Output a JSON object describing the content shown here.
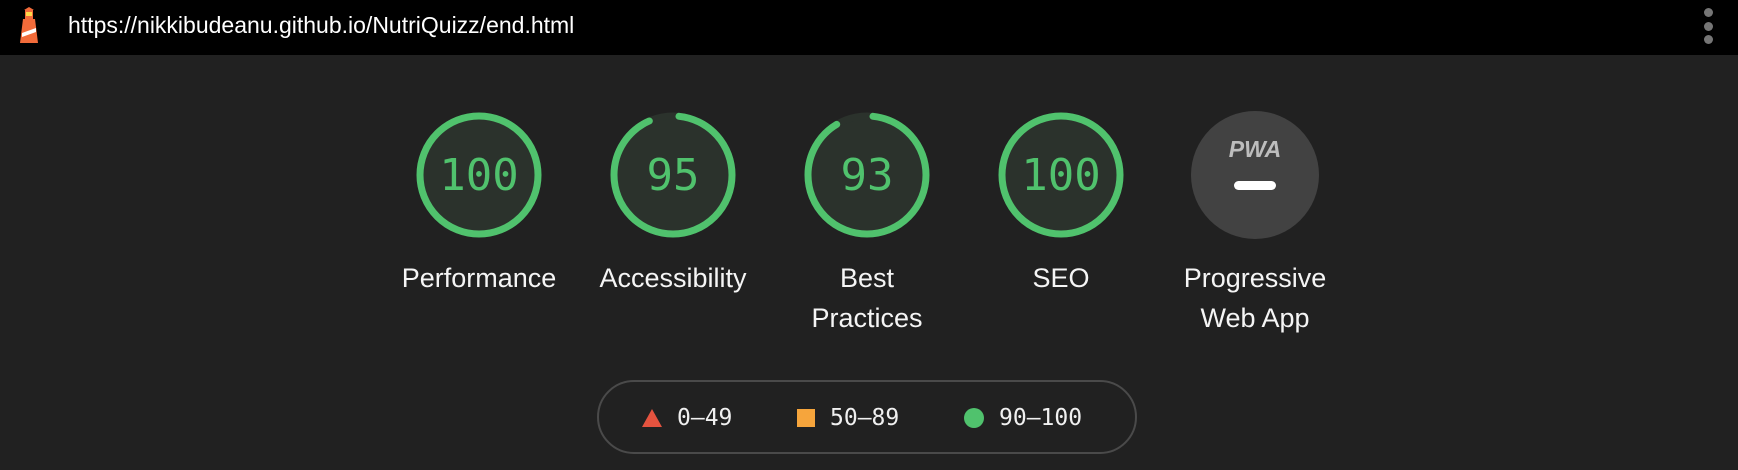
{
  "browser": {
    "url": "https://nikkibudeanu.github.io/NutriQuizz/end.html",
    "logo_icon": "lighthouse-icon",
    "menu_icon": "kebab-menu-icon"
  },
  "colors": {
    "pass": "#50c26d",
    "average": "#f6a53c",
    "fail": "#e5533f",
    "background": "#212121",
    "topbar": "#000000"
  },
  "gauges": [
    {
      "id": "performance",
      "label": "Performance",
      "value": "100",
      "score": 100
    },
    {
      "id": "accessibility",
      "label": "Accessibility",
      "value": "95",
      "score": 95
    },
    {
      "id": "best-practices",
      "label": "Best Practices",
      "value": "93",
      "score": 93
    },
    {
      "id": "seo",
      "label": "SEO",
      "value": "100",
      "score": 100
    }
  ],
  "pwa": {
    "label": "Progressive Web App",
    "badge": "PWA",
    "icon": "pwa-badge-icon"
  },
  "legend": [
    {
      "icon": "triangle-icon",
      "range": "0–49"
    },
    {
      "icon": "square-icon",
      "range": "50–89"
    },
    {
      "icon": "circle-icon",
      "range": "90–100"
    }
  ]
}
